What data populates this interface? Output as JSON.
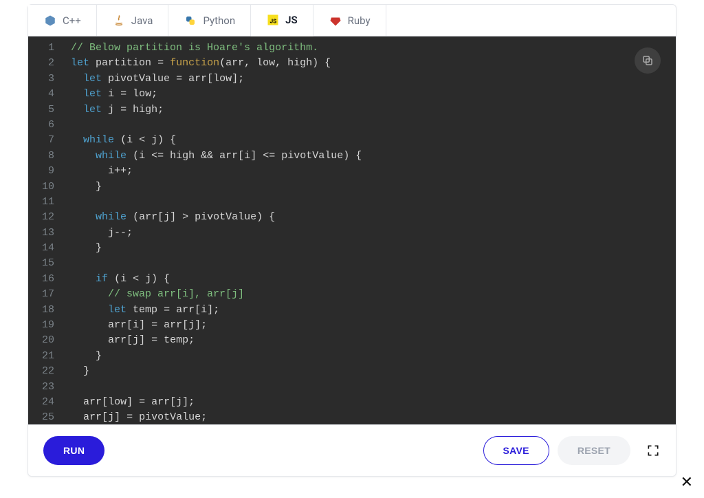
{
  "tabs": [
    {
      "label": "C++",
      "icon_color": "#5c8dbc",
      "active": false
    },
    {
      "label": "Java",
      "icon_color": "#c98a3a",
      "active": false
    },
    {
      "label": "Python",
      "icon_color": "#3776ab",
      "active": false
    },
    {
      "label": "JS",
      "icon_color": "#f7df1e",
      "active": true
    },
    {
      "label": "Ruby",
      "icon_color": "#cc342d",
      "active": false
    }
  ],
  "editor": {
    "line_numbers": [
      "1",
      "2",
      "3",
      "4",
      "5",
      "6",
      "7",
      "8",
      "9",
      "10",
      "11",
      "12",
      "13",
      "14",
      "15",
      "16",
      "17",
      "18",
      "19",
      "20",
      "21",
      "22",
      "23",
      "24",
      "25"
    ],
    "code_lines": [
      [
        [
          "comment",
          "// Below partition is Hoare's algorithm."
        ]
      ],
      [
        [
          "keyword",
          "let"
        ],
        [
          "ident",
          " partition "
        ],
        [
          "op",
          "= "
        ],
        [
          "func",
          "function"
        ],
        [
          "par",
          "("
        ],
        [
          "ident",
          "arr, low, high"
        ],
        [
          "par",
          ") {"
        ]
      ],
      [
        [
          "guide",
          "  "
        ],
        [
          "keyword",
          "let"
        ],
        [
          "ident",
          " pivotValue "
        ],
        [
          "op",
          "= "
        ],
        [
          "ident",
          "arr"
        ],
        [
          "par",
          "["
        ],
        [
          "ident",
          "low"
        ],
        [
          "par",
          "]"
        ],
        [
          "op",
          ";"
        ]
      ],
      [
        [
          "guide",
          "  "
        ],
        [
          "keyword",
          "let"
        ],
        [
          "ident",
          " i "
        ],
        [
          "op",
          "= "
        ],
        [
          "ident",
          "low"
        ],
        [
          "op",
          ";"
        ]
      ],
      [
        [
          "guide",
          "  "
        ],
        [
          "keyword",
          "let"
        ],
        [
          "ident",
          " j "
        ],
        [
          "op",
          "= "
        ],
        [
          "ident",
          "high"
        ],
        [
          "op",
          ";"
        ]
      ],
      [
        [
          "ident",
          ""
        ]
      ],
      [
        [
          "guide",
          "  "
        ],
        [
          "keyword",
          "while"
        ],
        [
          "ident",
          " "
        ],
        [
          "par",
          "("
        ],
        [
          "ident",
          "i "
        ],
        [
          "op",
          "< "
        ],
        [
          "ident",
          "j"
        ],
        [
          "par",
          ") {"
        ]
      ],
      [
        [
          "guide",
          "    "
        ],
        [
          "keyword",
          "while"
        ],
        [
          "ident",
          " "
        ],
        [
          "par",
          "("
        ],
        [
          "ident",
          "i "
        ],
        [
          "op",
          "<= "
        ],
        [
          "ident",
          "high "
        ],
        [
          "op",
          "&& "
        ],
        [
          "ident",
          "arr"
        ],
        [
          "par",
          "["
        ],
        [
          "ident",
          "i"
        ],
        [
          "par",
          "] "
        ],
        [
          "op",
          "<= "
        ],
        [
          "ident",
          "pivotValue"
        ],
        [
          "par",
          ") {"
        ]
      ],
      [
        [
          "guide",
          "      "
        ],
        [
          "ident",
          "i"
        ],
        [
          "op",
          "++;"
        ]
      ],
      [
        [
          "guide",
          "    "
        ],
        [
          "par",
          "}"
        ]
      ],
      [
        [
          "ident",
          ""
        ]
      ],
      [
        [
          "guide",
          "    "
        ],
        [
          "keyword",
          "while"
        ],
        [
          "ident",
          " "
        ],
        [
          "par",
          "("
        ],
        [
          "ident",
          "arr"
        ],
        [
          "par",
          "["
        ],
        [
          "ident",
          "j"
        ],
        [
          "par",
          "] "
        ],
        [
          "op",
          "> "
        ],
        [
          "ident",
          "pivotValue"
        ],
        [
          "par",
          ") {"
        ]
      ],
      [
        [
          "guide",
          "      "
        ],
        [
          "ident",
          "j"
        ],
        [
          "op",
          "--;"
        ]
      ],
      [
        [
          "guide",
          "    "
        ],
        [
          "par",
          "}"
        ]
      ],
      [
        [
          "ident",
          ""
        ]
      ],
      [
        [
          "guide",
          "    "
        ],
        [
          "keyword",
          "if"
        ],
        [
          "ident",
          " "
        ],
        [
          "par",
          "("
        ],
        [
          "ident",
          "i "
        ],
        [
          "op",
          "< "
        ],
        [
          "ident",
          "j"
        ],
        [
          "par",
          ") {"
        ]
      ],
      [
        [
          "guide",
          "      "
        ],
        [
          "comment",
          "// swap arr[i], arr[j]"
        ]
      ],
      [
        [
          "guide",
          "      "
        ],
        [
          "keyword",
          "let"
        ],
        [
          "ident",
          " temp "
        ],
        [
          "op",
          "= "
        ],
        [
          "ident",
          "arr"
        ],
        [
          "par",
          "["
        ],
        [
          "ident",
          "i"
        ],
        [
          "par",
          "]"
        ],
        [
          "op",
          ";"
        ]
      ],
      [
        [
          "guide",
          "      "
        ],
        [
          "ident",
          "arr"
        ],
        [
          "par",
          "["
        ],
        [
          "ident",
          "i"
        ],
        [
          "par",
          "] "
        ],
        [
          "op",
          "= "
        ],
        [
          "ident",
          "arr"
        ],
        [
          "par",
          "["
        ],
        [
          "ident",
          "j"
        ],
        [
          "par",
          "]"
        ],
        [
          "op",
          ";"
        ]
      ],
      [
        [
          "guide",
          "      "
        ],
        [
          "ident",
          "arr"
        ],
        [
          "par",
          "["
        ],
        [
          "ident",
          "j"
        ],
        [
          "par",
          "] "
        ],
        [
          "op",
          "= "
        ],
        [
          "ident",
          "temp"
        ],
        [
          "op",
          ";"
        ]
      ],
      [
        [
          "guide",
          "    "
        ],
        [
          "par",
          "}"
        ]
      ],
      [
        [
          "guide",
          "  "
        ],
        [
          "par",
          "}"
        ]
      ],
      [
        [
          "ident",
          ""
        ]
      ],
      [
        [
          "guide",
          "  "
        ],
        [
          "ident",
          "arr"
        ],
        [
          "par",
          "["
        ],
        [
          "ident",
          "low"
        ],
        [
          "par",
          "] "
        ],
        [
          "op",
          "= "
        ],
        [
          "ident",
          "arr"
        ],
        [
          "par",
          "["
        ],
        [
          "ident",
          "j"
        ],
        [
          "par",
          "]"
        ],
        [
          "op",
          ";"
        ]
      ],
      [
        [
          "guide",
          "  "
        ],
        [
          "ident",
          "arr"
        ],
        [
          "par",
          "["
        ],
        [
          "ident",
          "j"
        ],
        [
          "par",
          "] "
        ],
        [
          "op",
          "= "
        ],
        [
          "ident",
          "pivotValue"
        ],
        [
          "op",
          ";"
        ]
      ]
    ]
  },
  "toolbar": {
    "run_label": "RUN",
    "save_label": "SAVE",
    "reset_label": "RESET"
  },
  "close_glyph": "✕"
}
